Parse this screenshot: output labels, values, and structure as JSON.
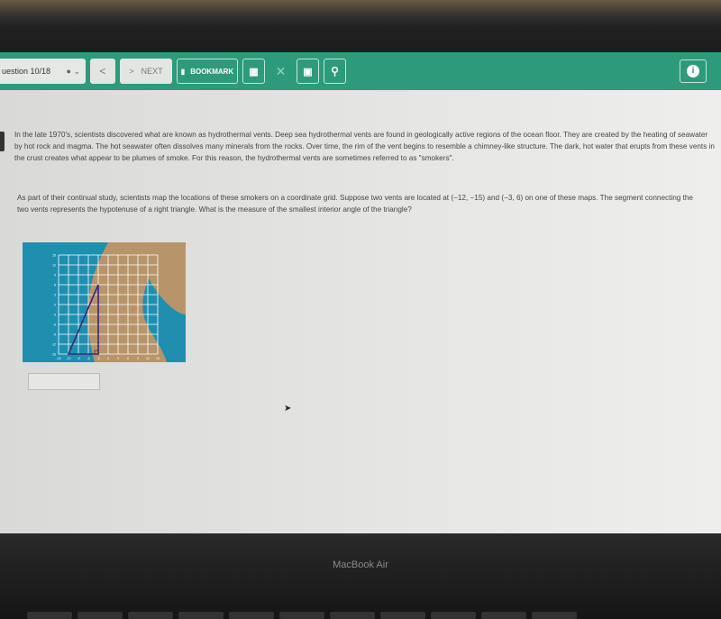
{
  "toolbar": {
    "question_label": "uestion 10/18",
    "prev_icon": "chevron-left",
    "next_label": "NEXT",
    "bookmark_label": "BOOKMARK",
    "icons": [
      "grid-icon",
      "close-icon",
      "calculator-icon",
      "search-icon",
      "info-icon"
    ]
  },
  "passage": "In the late 1970's, scientists discovered what are known as hydrothermal vents. Deep sea hydrothermal vents are found in geologically active regions of the ocean floor. They are created by the heating of seawater by hot rock and magma. The hot seawater often dissolves many minerals from the rocks. Over time, the rim of the vent begins to resemble a chimney-like structure. The dark, hot water that erupts from these vents in the crust creates what appear to be plumes of smoke. For this reason, the hydrothermal vents are sometimes referred to as \"smokers\".",
  "question": "As part of their continual study, scientists map the locations of these smokers on a coordinate grid. Suppose two vents are located at (−12, −15) and (−3, 6) on one of these maps. The segment connecting the two vents represents the hypotenuse of a right triangle. What is the measure of the smallest interior angle of the triangle?",
  "figure": {
    "x_ticks": [
      "-15",
      "-12",
      "-9",
      "-6",
      "-3",
      "0",
      "3",
      "6",
      "9",
      "12",
      "15"
    ],
    "y_ticks": [
      "15",
      "12",
      "9",
      "6",
      "3",
      "0",
      "-3",
      "-6",
      "-9",
      "-12",
      "-15"
    ],
    "points": [
      [
        -12,
        -15
      ],
      [
        -3,
        6
      ],
      [
        -3,
        -15
      ]
    ],
    "colors": {
      "water": "#1f8fb0",
      "sand": "#b8946a",
      "triangle": "#3a2a7a"
    }
  },
  "answer_value": "",
  "device_label": "MacBook Air"
}
